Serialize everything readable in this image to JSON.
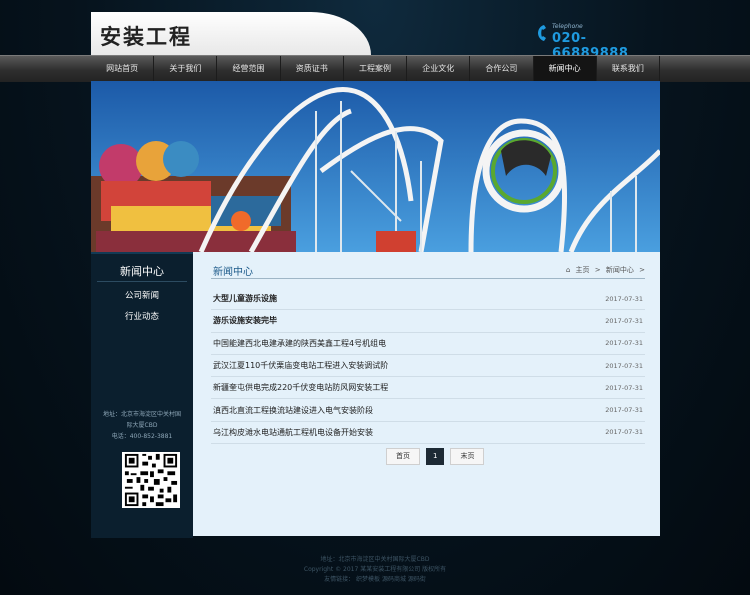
{
  "header": {
    "logo": "安装工程",
    "phone_label": "Telephone",
    "phone_number": "020-66889888"
  },
  "nav": {
    "items": [
      {
        "label": "网站首页"
      },
      {
        "label": "关于我们"
      },
      {
        "label": "经营范围"
      },
      {
        "label": "资质证书"
      },
      {
        "label": "工程案例"
      },
      {
        "label": "企业文化"
      },
      {
        "label": "合作公司"
      },
      {
        "label": "新闻中心",
        "active": true
      },
      {
        "label": "联系我们"
      }
    ]
  },
  "sidebar": {
    "title": "新闻中心",
    "links": [
      "公司新闻",
      "行业动态"
    ],
    "address_line1": "地址：北京市海淀区中关村国",
    "address_line2": "际大厦CBD",
    "phone": "电话：400-852-3881"
  },
  "content": {
    "title": "新闻中心",
    "breadcrumb": {
      "home": "主页",
      "sep": ">",
      "current": "新闻中心",
      "sep2": ">"
    },
    "news": [
      {
        "title": "大型儿童游乐设施",
        "date": "2017-07-31",
        "bold": true
      },
      {
        "title": "游乐设施安装完毕",
        "date": "2017-07-31",
        "bold": true
      },
      {
        "title": "中国能建西北电建承建的陕西美鑫工程4号机组电",
        "date": "2017-07-31"
      },
      {
        "title": "武汉江夏110千伏栗庙变电站工程进入安装调试阶",
        "date": "2017-07-31"
      },
      {
        "title": "新疆奎屯供电完成220千伏变电站防风网安装工程",
        "date": "2017-07-31"
      },
      {
        "title": "滇西北直流工程换流站建设进入电气安装阶段",
        "date": "2017-07-31"
      },
      {
        "title": "乌江构皮滩水电站通航工程机电设备开始安装",
        "date": "2017-07-31"
      }
    ],
    "pager": {
      "first": "首页",
      "current": "1",
      "last": "末页"
    }
  },
  "footer": {
    "line1": "地址：北京市海淀区中关村国际大厦CBD",
    "line2": "Copyright © 2017 某某安装工程有限公司 版权所有",
    "line3": "友情链接：   织梦模板   源码商城   源码街"
  }
}
